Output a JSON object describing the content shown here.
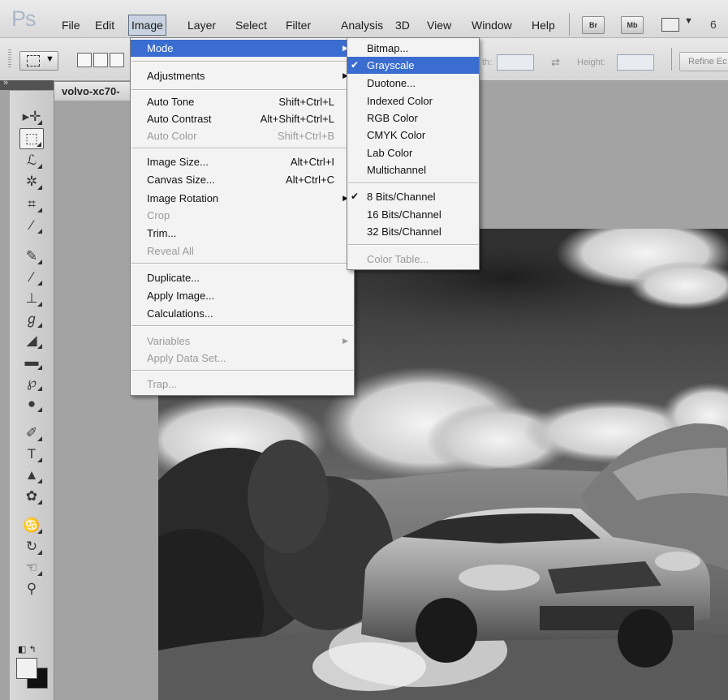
{
  "app_logo": "Ps",
  "menubar": {
    "items": [
      "File",
      "Edit",
      "Image",
      "Layer",
      "Select",
      "Filter",
      "Analysis",
      "3D",
      "View",
      "Window",
      "Help"
    ],
    "bridge_label": "Br",
    "mini_bridge_label": "Mb",
    "zoom_partial": "6"
  },
  "options_bar": {
    "width_label": "th:",
    "height_label": "Height:",
    "width_value": "",
    "height_value": "",
    "refine_label": "Refine Ec"
  },
  "document_tab": {
    "title": "volvo-xc70-"
  },
  "image_menu": {
    "items": [
      {
        "label": "Mode",
        "submenu": true,
        "highlighted": true
      },
      {
        "label": "Adjustments",
        "submenu": true
      },
      {
        "label": "Auto Tone",
        "shortcut": "Shift+Ctrl+L"
      },
      {
        "label": "Auto Contrast",
        "shortcut": "Alt+Shift+Ctrl+L"
      },
      {
        "label": "Auto Color",
        "shortcut": "Shift+Ctrl+B",
        "disabled": true
      },
      {
        "label": "Image Size...",
        "shortcut": "Alt+Ctrl+I"
      },
      {
        "label": "Canvas Size...",
        "shortcut": "Alt+Ctrl+C"
      },
      {
        "label": "Image Rotation",
        "submenu": true
      },
      {
        "label": "Crop",
        "disabled": true
      },
      {
        "label": "Trim..."
      },
      {
        "label": "Reveal All",
        "disabled": true
      },
      {
        "label": "Duplicate..."
      },
      {
        "label": "Apply Image..."
      },
      {
        "label": "Calculations..."
      },
      {
        "label": "Variables",
        "submenu": true,
        "disabled": true
      },
      {
        "label": "Apply Data Set...",
        "disabled": true
      },
      {
        "label": "Trap...",
        "disabled": true
      }
    ]
  },
  "mode_menu": {
    "items": [
      {
        "label": "Bitmap..."
      },
      {
        "label": "Grayscale",
        "checked": true,
        "highlighted": true
      },
      {
        "label": "Duotone..."
      },
      {
        "label": "Indexed Color"
      },
      {
        "label": "RGB Color"
      },
      {
        "label": "CMYK Color"
      },
      {
        "label": "Lab Color"
      },
      {
        "label": "Multichannel"
      },
      {
        "label": "8 Bits/Channel",
        "checked": true
      },
      {
        "label": "16 Bits/Channel"
      },
      {
        "label": "32 Bits/Channel"
      },
      {
        "label": "Color Table...",
        "disabled": true
      }
    ]
  },
  "tools": [
    "move-tool",
    "marquee-tool",
    "lasso-tool",
    "quick-selection-tool",
    "crop-tool",
    "eyedropper-tool",
    "spot-healing-tool",
    "brush-tool",
    "clone-stamp-tool",
    "history-brush-tool",
    "eraser-tool",
    "gradient-tool",
    "blur-tool",
    "dodge-tool",
    "pen-tool",
    "type-tool",
    "path-selection-tool",
    "shape-tool",
    "3d-rotate-tool",
    "3d-orbit-tool",
    "hand-tool",
    "zoom-tool"
  ],
  "colors": {
    "menu_highlight": "#3a6dcf",
    "foreground_swatch": "#f1f1f1",
    "background_swatch": "#111111"
  }
}
